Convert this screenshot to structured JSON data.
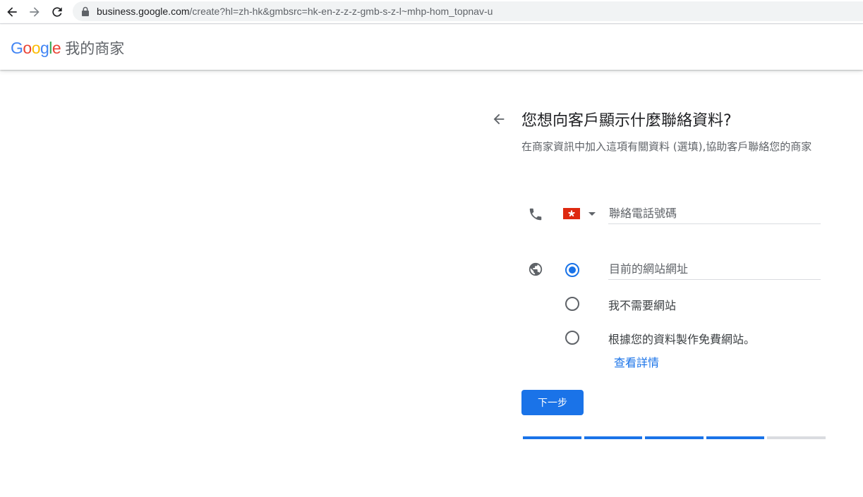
{
  "browser": {
    "url_host": "business.google.com",
    "url_path": "/create?hl=zh-hk&gmbsrc=hk-en-z-z-z-gmb-s-z-l~mhp-hom_topnav-u"
  },
  "header": {
    "logo_text": "Google",
    "product_name": "我的商家"
  },
  "form": {
    "title": "您想向客戶顯示什麼聯絡資料?",
    "subtitle": "在商家資訊中加入這項有關資料 (選填),協助客戶聯絡您的商家",
    "phone": {
      "country": "Hong Kong",
      "placeholder": "聯絡電話號碼",
      "value": ""
    },
    "website": {
      "options": [
        {
          "label": "目前的網站網址",
          "kind": "input",
          "checked": true
        },
        {
          "label": "我不需要網站",
          "checked": false
        },
        {
          "label": "根據您的資料製作免費網站。",
          "checked": false
        }
      ],
      "details_link": "查看詳情"
    },
    "next_label": "下一步"
  },
  "progress": {
    "total_steps": 5,
    "completed_steps": 4
  },
  "colors": {
    "accent": "#1a73e8",
    "flag_red": "#de2910",
    "inactive": "#dadce0"
  },
  "icons": {
    "back": "arrow-back-icon",
    "forward": "arrow-forward-icon",
    "reload": "reload-icon",
    "lock": "lock-icon",
    "phone": "phone-icon",
    "web": "globe-icon",
    "form_back": "arrow-back-icon"
  }
}
